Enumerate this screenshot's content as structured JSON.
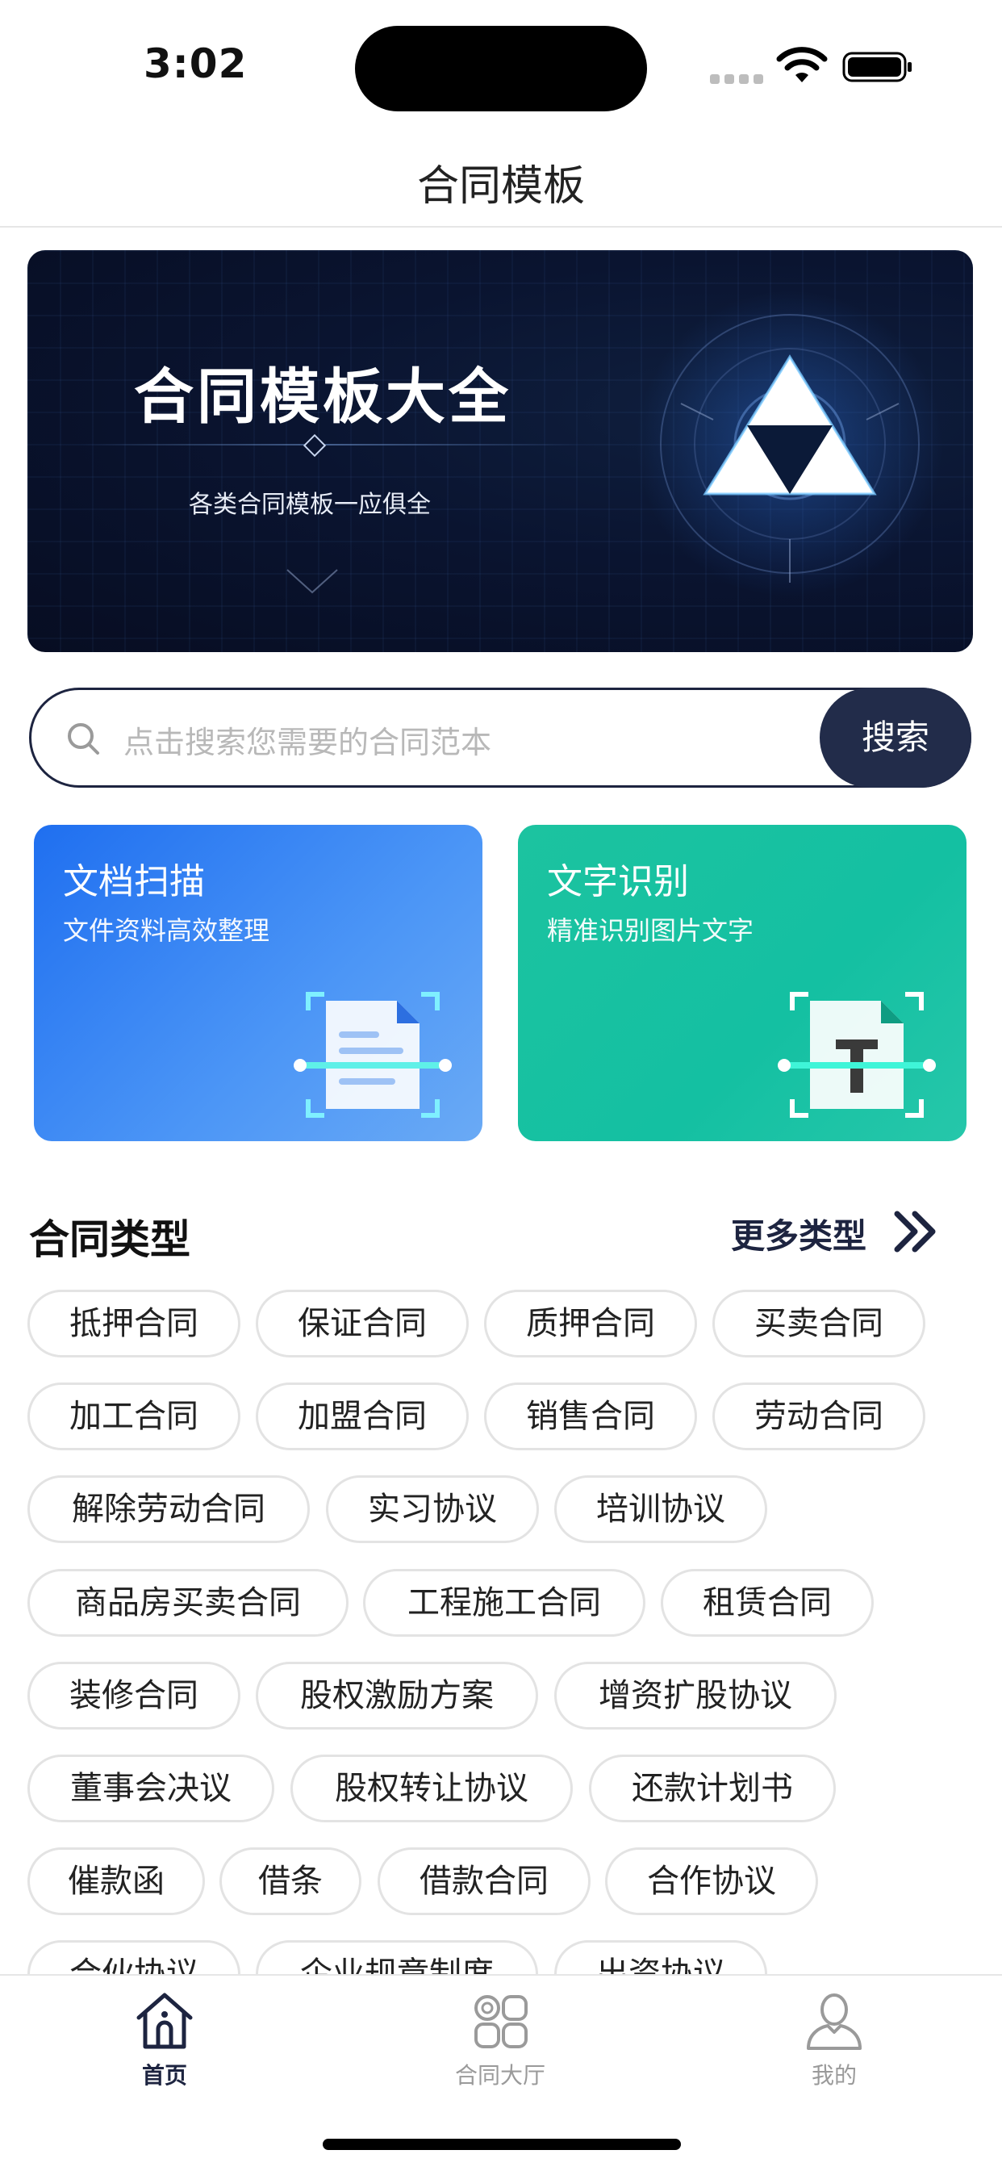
{
  "status_bar": {
    "time": "3:02"
  },
  "nav": {
    "title": "合同模板"
  },
  "banner": {
    "title": "合同模板大全",
    "subtitle": "各类合同模板一应俱全"
  },
  "search": {
    "placeholder": "点击搜索您需要的合同范本",
    "button_label": "搜索"
  },
  "cards": [
    {
      "title": "文档扫描",
      "desc": "文件资料高效整理"
    },
    {
      "title": "文字识别",
      "desc": "精准识别图片文字"
    }
  ],
  "section": {
    "title": "合同类型",
    "more_label": "更多类型"
  },
  "tag_rows": [
    [
      "抵押合同",
      "保证合同",
      "质押合同",
      "买卖合同"
    ],
    [
      "加工合同",
      "加盟合同",
      "销售合同",
      "劳动合同"
    ],
    [
      "解除劳动合同",
      "实习协议",
      "培训协议"
    ],
    [
      "商品房买卖合同",
      "工程施工合同",
      "租赁合同"
    ],
    [
      "装修合同",
      "股权激励方案",
      "增资扩股协议"
    ],
    [
      "董事会决议",
      "股权转让协议",
      "还款计划书"
    ],
    [
      "催款函",
      "借条",
      "借款合同",
      "合作协议"
    ],
    [
      "合伙协议",
      "企业规章制度",
      "出资协议"
    ]
  ],
  "tab_bar": {
    "items": [
      {
        "label": "首页",
        "icon": "home-icon",
        "active": true
      },
      {
        "label": "合同大厅",
        "icon": "grid-icon",
        "active": false
      },
      {
        "label": "我的",
        "icon": "user-icon",
        "active": false
      }
    ]
  },
  "colors": {
    "accent": "#1d2440",
    "scan_card": "#2f7ff2",
    "ocr_card": "#19c2a2",
    "inactive": "#9a9a9a"
  }
}
